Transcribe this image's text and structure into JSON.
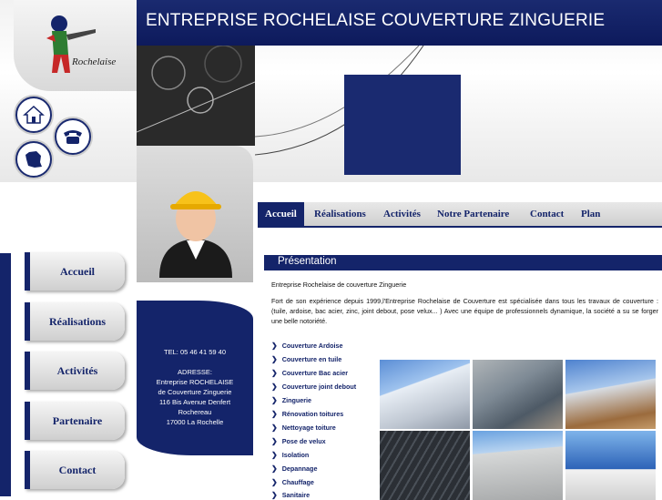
{
  "header": {
    "title": "ENTREPRISE ROCHELAISE COUVERTURE ZINGUERIE",
    "logo_text": "Rochelaise"
  },
  "icons": [
    "home-icon",
    "phone-icon",
    "france-map-icon"
  ],
  "top_nav": [
    "Accueil",
    "Réalisations",
    "Activités",
    "Notre Partenaire",
    "Contact",
    "Plan"
  ],
  "side_nav": [
    "Accueil",
    "Réalisations",
    "Activités",
    "Partenaire",
    "Contact"
  ],
  "contact": {
    "tel": "TEL: 05 46 41 59 40",
    "address_label": "ADRESSE:",
    "address_lines": [
      "Entreprise ROCHELAISE",
      "de Couverture Zinguerie",
      "116 Bis Avenue Denfert",
      "Rochereau",
      "17000 La Rochelle"
    ]
  },
  "main": {
    "section_title": "Présentation",
    "intro": "Entreprise Rochelaise de couverture Zinguerie",
    "paragraph": "Fort de son expérience depuis 1999,l'Entreprise Rochelaise de Couverture est spécialisée dans tous les travaux de couverture : (tuile, ardoise, bac acier, zinc, joint debout, pose velux... ) Avec une équipe de professionnels dynamique, la société a su se forger une belle notoriété.",
    "services": [
      "Couverture Ardoise",
      "Couverture en tuile",
      "Couverture Bac acier",
      "Couverture joint debout",
      "Zinguerie",
      "Rénovation toitures",
      "Nettoyage toiture",
      "Pose de velux",
      "Isolation",
      "Depannage",
      "Chauffage",
      "Sanitaire"
    ]
  },
  "colors": {
    "brand_blue": "#14246a",
    "highlight": "#1a2a70"
  }
}
